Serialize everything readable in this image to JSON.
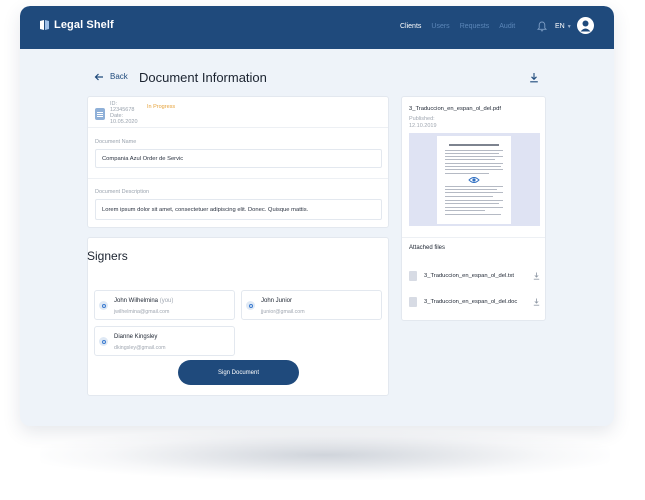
{
  "app": {
    "brand": "Legal Shelf"
  },
  "nav": {
    "items": [
      {
        "label": "Clients",
        "active": true
      },
      {
        "label": "Users",
        "active": false
      },
      {
        "label": "Requests",
        "active": false
      },
      {
        "label": "Audit",
        "active": false
      }
    ],
    "language": "EN"
  },
  "header": {
    "back_label": "Back",
    "title": "Document Information"
  },
  "document": {
    "id_label": "ID:",
    "id_value": "12345678",
    "date_label": "Date:",
    "date_value": "10.05.2020",
    "status": "In Progress",
    "name_label": "Document Name",
    "name_value": "Compania Azul Order de Servic",
    "description_label": "Document Description",
    "description_value": "Lorem ipsum dolor sit amet, consectetuer adipiscing elit. Donec. Quisque mattis."
  },
  "signers": {
    "title": "Signers",
    "items": [
      {
        "name": "John Wilhelmina",
        "tag": "(you)",
        "email": "jwilhelmina@gmail.com"
      },
      {
        "name": "John Junior",
        "tag": "",
        "email": "jjunior@gmail.com"
      },
      {
        "name": "Dianne Kingsley",
        "tag": "",
        "email": "dkingsley@gmail.com"
      }
    ],
    "sign_button": "Sign Document"
  },
  "file_panel": {
    "file_name": "3_Traduccion_en_espan_ol_del.pdf",
    "published_label": "Published:",
    "published_date": "12.10.2019",
    "attached_title": "Attached files",
    "attachments": [
      {
        "name": "3_Traduccion_en_espan_ol_del.txt"
      },
      {
        "name": "3_Traduccion_en_espan_ol_del.doc"
      }
    ]
  },
  "colors": {
    "primary": "#1f4a7c",
    "background": "#eef3f9",
    "status_in_progress": "#e6a33c"
  },
  "icons": [
    "logo-icon",
    "bell-icon",
    "avatar-icon",
    "back-arrow-icon",
    "download-icon",
    "document-icon",
    "signer-icon",
    "eye-icon",
    "file-icon"
  ]
}
